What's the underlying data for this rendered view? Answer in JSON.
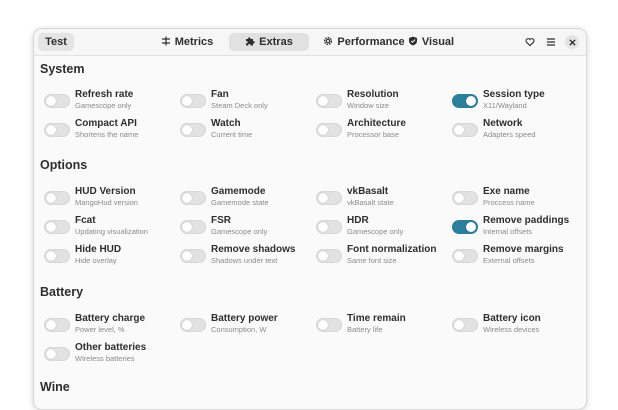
{
  "header": {
    "test_button": "Test",
    "tabs": [
      {
        "label": "Metrics",
        "icon": "sliders-icon",
        "active": false
      },
      {
        "label": "Extras",
        "icon": "puzzle-icon",
        "active": true
      },
      {
        "label": "Performance",
        "icon": "gear-icon",
        "active": false
      },
      {
        "label": "Visual",
        "icon": "shield-icon",
        "active": false
      }
    ],
    "icons": [
      "heart-icon",
      "menu-icon",
      "close-icon"
    ]
  },
  "colors": {
    "accent": "#2a7f9a",
    "switch_off": "#e2e2e2",
    "background": "#fafafa"
  },
  "sections": [
    {
      "title": "System",
      "items": [
        {
          "label": "Refresh rate",
          "sub": "Gamescope only",
          "on": false
        },
        {
          "label": "Fan",
          "sub": "Steam Deck only",
          "on": false
        },
        {
          "label": "Resolution",
          "sub": "Window size",
          "on": false
        },
        {
          "label": "Session type",
          "sub": "X11/Wayland",
          "on": true
        },
        {
          "label": "Compact API",
          "sub": "Shortens the name",
          "on": false
        },
        {
          "label": "Watch",
          "sub": "Current time",
          "on": false
        },
        {
          "label": "Architecture",
          "sub": "Processor base",
          "on": false
        },
        {
          "label": "Network",
          "sub": "Adapters speed",
          "on": false
        }
      ]
    },
    {
      "title": "Options",
      "items": [
        {
          "label": "HUD Version",
          "sub": "MangoHud version",
          "on": false
        },
        {
          "label": "Gamemode",
          "sub": "Gamemode state",
          "on": false
        },
        {
          "label": "vkBasalt",
          "sub": "vkBasalt state",
          "on": false
        },
        {
          "label": "Exe name",
          "sub": "Proccess name",
          "on": false
        },
        {
          "label": "Fcat",
          "sub": "Updating visualization",
          "on": false
        },
        {
          "label": "FSR",
          "sub": "Gamescope only",
          "on": false
        },
        {
          "label": "HDR",
          "sub": "Gamescope only",
          "on": false
        },
        {
          "label": "Remove paddings",
          "sub": "Internal offsets",
          "on": true
        },
        {
          "label": "Hide HUD",
          "sub": "Hide overlay",
          "on": false
        },
        {
          "label": "Remove shadows",
          "sub": "Shadows under text",
          "on": false
        },
        {
          "label": "Font normalization",
          "sub": "Same font size",
          "on": false
        },
        {
          "label": "Remove margins",
          "sub": "External offsets",
          "on": false
        }
      ]
    },
    {
      "title": "Battery",
      "items": [
        {
          "label": "Battery charge",
          "sub": "Power level, %",
          "on": false
        },
        {
          "label": "Battery power",
          "sub": "Consumption, W",
          "on": false
        },
        {
          "label": "Time remain",
          "sub": "Battery life",
          "on": false
        },
        {
          "label": "Battery icon",
          "sub": "Wireless devices",
          "on": false
        },
        {
          "label": "Other batteries",
          "sub": "Wireless batteries",
          "on": false
        }
      ]
    },
    {
      "title": "Wine",
      "items": []
    }
  ]
}
